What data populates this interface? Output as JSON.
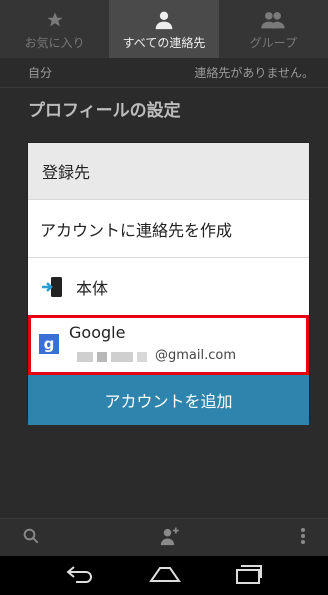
{
  "tabs": [
    {
      "label": "お気に入り",
      "icon": "star-icon"
    },
    {
      "label": "すべての連絡先",
      "icon": "person-icon"
    },
    {
      "label": "グループ",
      "icon": "group-icon"
    }
  ],
  "me_row": {
    "left": "自分",
    "right": "連絡先がありません。"
  },
  "profile_label": "プロフィールの設定",
  "dialog": {
    "title": "登録先",
    "create_option": "アカウントに連絡先を作成",
    "device_option": "本体",
    "google": {
      "name": "Google",
      "email": "@gmail.com"
    },
    "add_account_button": "アカウントを追加"
  },
  "colors": {
    "accent": "#2f84ad",
    "highlight": "#e60012"
  }
}
